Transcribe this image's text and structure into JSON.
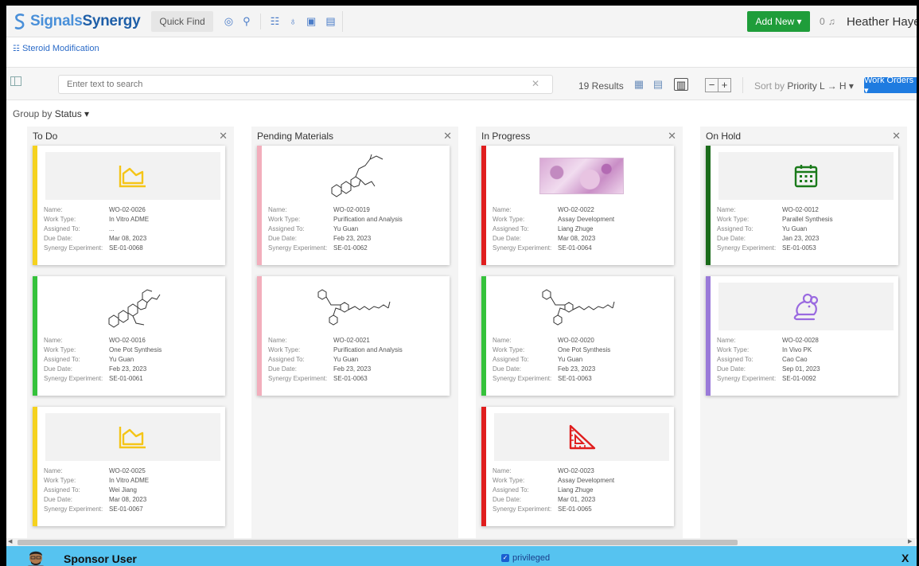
{
  "app": {
    "logo_part1": "Signals",
    "logo_part2": "Synergy",
    "quick_find": "Quick Find",
    "add_new": "Add New ▾",
    "notification_count": "0",
    "user_name": "Heather Hayes ▾"
  },
  "breadcrumb": {
    "label": "Steroid Modification"
  },
  "toolbar": {
    "search_placeholder": "Enter text to search",
    "results": "19 Results",
    "zoom_minus": "−",
    "zoom_plus": "+",
    "sort_prefix": "Sort by",
    "sort_value": "Priority L → H ▾",
    "work_orders": "Work Orders ▾"
  },
  "group_by": {
    "prefix": "Group by",
    "value": "Status ▾"
  },
  "field_labels": {
    "name": "Name:",
    "work_type": "Work Type:",
    "assigned_to": "Assigned To:",
    "due_date": "Due Date:",
    "experiment": "Synergy Experiment:"
  },
  "columns": [
    {
      "title": "To Do",
      "cards": [
        {
          "name": "WO-02-0026",
          "work_type": "In Vitro ADME",
          "assigned_to": "...",
          "due_date": "Mar 08, 2023",
          "experiment": "SE-01-0068",
          "icon": "chart-area-icon",
          "color": "#f5d21f"
        },
        {
          "name": "WO-02-0016",
          "work_type": "One Pot Synthesis",
          "assigned_to": "Yu Guan",
          "due_date": "Feb 23, 2023",
          "experiment": "SE-01-0061",
          "icon": "molecule-structure",
          "color": "#35c23b"
        },
        {
          "name": "WO-02-0025",
          "work_type": "In Vitro ADME",
          "assigned_to": "Wei Jiang",
          "due_date": "Mar 08, 2023",
          "experiment": "SE-01-0067",
          "icon": "chart-area-icon",
          "color": "#f5d21f"
        }
      ]
    },
    {
      "title": "Pending Materials",
      "cards": [
        {
          "name": "WO-02-0019",
          "work_type": "Purification and Analysis",
          "assigned_to": "Yu Guan",
          "due_date": "Feb 23, 2023",
          "experiment": "SE-01-0062",
          "icon": "molecule-structure",
          "color": "#f2aebc"
        },
        {
          "name": "WO-02-0021",
          "work_type": "Purification and Analysis",
          "assigned_to": "Yu Guan",
          "due_date": "Feb 23, 2023",
          "experiment": "SE-01-0063",
          "icon": "molecule-structure",
          "color": "#f2aebc"
        }
      ]
    },
    {
      "title": "In Progress",
      "cards": [
        {
          "name": "WO-02-0022",
          "work_type": "Assay Development",
          "assigned_to": "Liang Zhuge",
          "due_date": "Mar 08, 2023",
          "experiment": "SE-01-0064",
          "icon": "tissue-image",
          "color": "#e01e1e"
        },
        {
          "name": "WO-02-0020",
          "work_type": "One Pot Synthesis",
          "assigned_to": "Yu Guan",
          "due_date": "Feb 23, 2023",
          "experiment": "SE-01-0063",
          "icon": "molecule-structure",
          "color": "#35c23b"
        },
        {
          "name": "WO-02-0023",
          "work_type": "Assay Development",
          "assigned_to": "Liang Zhuge",
          "due_date": "Mar 01, 2023",
          "experiment": "SE-01-0065",
          "icon": "set-square-icon",
          "color": "#e01e1e"
        }
      ]
    },
    {
      "title": "On Hold",
      "cards": [
        {
          "name": "WO-02-0012",
          "work_type": "Parallel Synthesis",
          "assigned_to": "Yu Guan",
          "due_date": "Jan 23, 2023",
          "experiment": "SE-01-0053",
          "icon": "calendar-icon",
          "color": "#1a6b1a"
        },
        {
          "name": "WO-02-0028",
          "work_type": "In Vivo PK",
          "assigned_to": "Cao Cao",
          "due_date": "Sep 01, 2023",
          "experiment": "SE-01-0092",
          "icon": "mouse-icon",
          "color": "#9a7ad9"
        }
      ]
    }
  ],
  "sponsor_bar": {
    "name": "Sponsor User",
    "checkbox_label": "privileged",
    "close": "X",
    "color": "#56c3f0"
  }
}
